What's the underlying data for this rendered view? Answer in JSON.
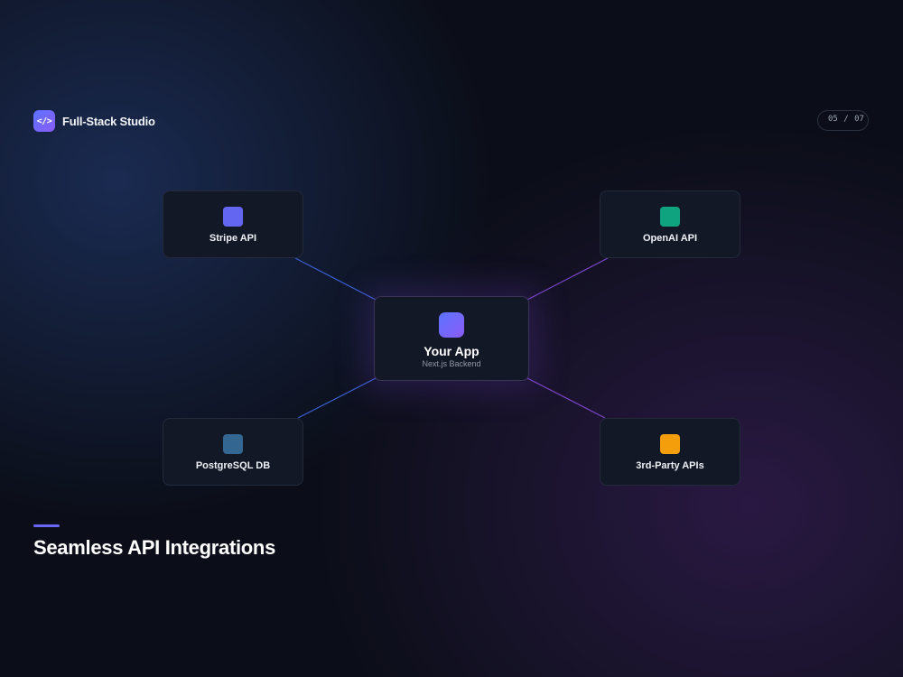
{
  "header": {
    "brand_icon": "code-icon",
    "brand_icon_glyph": "</>",
    "brand_name": "Full-Stack Studio",
    "page_current": "05",
    "page_separator": "/",
    "page_total": "07"
  },
  "diagram": {
    "center": {
      "title": "Your App",
      "subtitle": "Next.js Backend",
      "icon_colors": [
        "#5b73ff",
        "#8b5cf6"
      ]
    },
    "nodes": [
      {
        "label": "Stripe API",
        "icon_color": "#6366f1",
        "position": "top-left"
      },
      {
        "label": "OpenAI API",
        "icon_color": "#10a37f",
        "position": "top-right"
      },
      {
        "label": "PostgreSQL DB",
        "icon_color": "#336791",
        "position": "bottom-left"
      },
      {
        "label": "3rd-Party APIs",
        "icon_color": "#f59e0b",
        "position": "bottom-right"
      }
    ],
    "connector_colors": {
      "left": "#3b5fd1",
      "right": "#7b46c9"
    }
  },
  "title": "Seamless API Integrations",
  "accent_color": "#6a65f5"
}
